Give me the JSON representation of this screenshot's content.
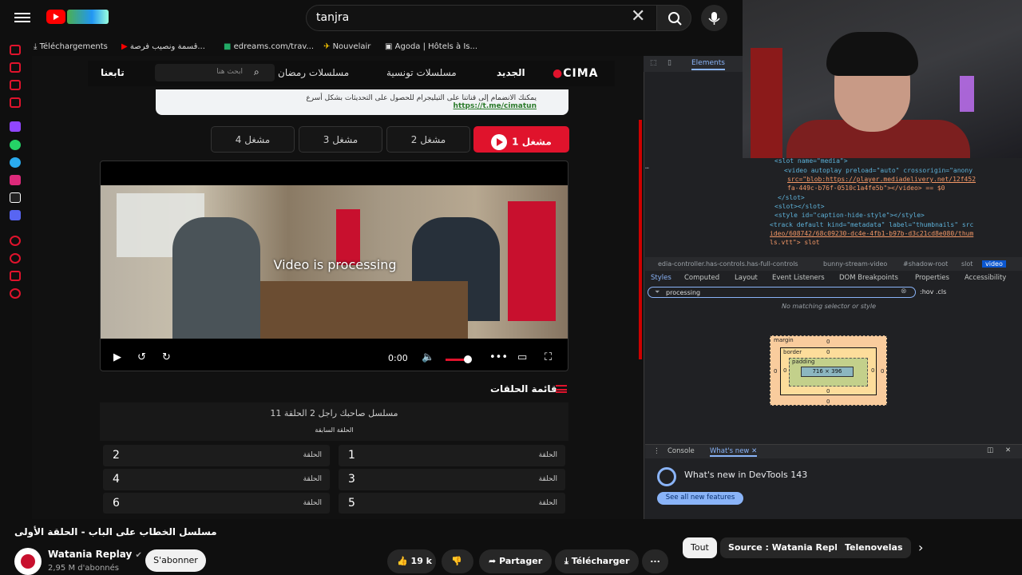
{
  "youtube": {
    "search_value": "tanjra",
    "bookmarks": [
      "Téléchargements",
      "قسمة ونصيب فرصة...",
      "edreams.com/trav...",
      "Nouvelair",
      "Agoda | Hôtels à Is..."
    ]
  },
  "site": {
    "logo": "CIMA",
    "nav": [
      "الجديد",
      "مسلسلات تونسية",
      "مسلسلات رمضان",
      "تابعنا"
    ],
    "search_placeholder": "ابحث هنا",
    "notice_text": "يمكنك الانضمام إلى قناتنا على التيليجرام للحصول على التحديثات بشكل أسرع",
    "notice_link": "https://t.me/cimatun",
    "servers": [
      "مشغل 1",
      "مشغل 2",
      "مشغل 3",
      "مشغل 4"
    ]
  },
  "player": {
    "message": "Video is processing",
    "time": "0:00",
    "volume_level": 0.6
  },
  "episodes": {
    "title": "قائمة الحلقات",
    "series": "مسلسل صاحبك راجل 2 الحلقة 11",
    "previous": "الحلقة السابقة",
    "label": "الحلقة",
    "items": [
      "1",
      "2",
      "3",
      "4",
      "5",
      "6"
    ]
  },
  "video": {
    "title": "مسلسل الخطاب على الباب - الحلقة الأولى",
    "channel": "Watania Replay",
    "subscribers": "2,95 M d'abonnés",
    "subscribe": "S'abonner",
    "likes": "19 k",
    "share": "Partager",
    "download": "Télécharger",
    "more": "..."
  },
  "chips": [
    "Tout",
    "Source : Watania Replay",
    "Telenovelas"
  ],
  "devtools": {
    "tab_active": "Elements",
    "code": [
      "<slot name=\"media\">",
      "<video autoplay preload=\"auto\" crossorigin=\"anony",
      "src=\"blob:https://player.mediadelivery.net/12f452",
      "fa-449c-b76f-0510c1a4fe5b\"></video> == $0",
      "</slot>",
      "<slot></slot>",
      "<style id=\"caption-hide-style\"></style>",
      "<track default kind=\"metadata\" label=\"thumbnails\" src",
      "ideo/608742/68c09230-dc4e-4fb1-b97b-d3c21cd8e080/thum",
      "ls.vtt\"> slot"
    ],
    "breadcrumbs": [
      "edia-controller.has-controls.has-full-controls",
      "bunny-stream-video",
      "#shadow-root",
      "slot",
      "video"
    ],
    "style_tabs": [
      "Styles",
      "Computed",
      "Layout",
      "Event Listeners",
      "DOM Breakpoints",
      "Properties",
      "Accessibility"
    ],
    "filter_value": "processing",
    "filter_tools": ":hov  .cls",
    "no_match": "No matching selector or style",
    "box": {
      "margin": "margin",
      "border": "border",
      "padding": "padding",
      "content": "716 × 396",
      "zero": "0"
    },
    "drawer_tabs": [
      "Console",
      "What's new"
    ],
    "whats_new": "What's new in DevTools 143",
    "see_all": "See all new features"
  }
}
